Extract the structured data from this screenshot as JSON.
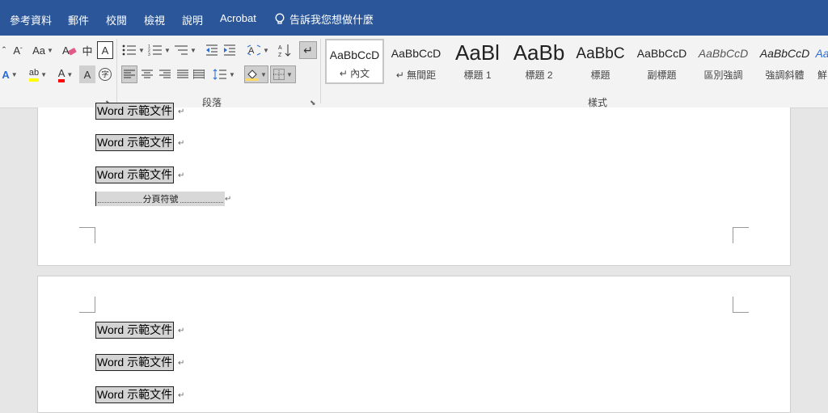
{
  "menu": {
    "tabs": [
      "參考資料",
      "郵件",
      "校閱",
      "檢視",
      "說明",
      "Acrobat"
    ],
    "tell_me": "告訴我您想做什麼"
  },
  "ribbon": {
    "font_group": {
      "case_button": "Aa",
      "phonetic_button": "中",
      "char_border_button": "A",
      "text_effect_button": "A",
      "highlight_button": "ab",
      "font_color_button": "A",
      "char_shade_button": "A",
      "enclose_button": "字"
    },
    "paragraph_group": {
      "label": "段落"
    },
    "styles_group": {
      "label": "樣式",
      "items": [
        {
          "sample": "AaBbCcD",
          "name": "↵ 內文"
        },
        {
          "sample": "AaBbCcD",
          "name": "↵ 無間距"
        },
        {
          "sample": "AaBl",
          "name": "標題 1"
        },
        {
          "sample": "AaBb",
          "name": "標題 2"
        },
        {
          "sample": "AaBbC",
          "name": "標題"
        },
        {
          "sample": "AaBbCcD",
          "name": "副標題"
        },
        {
          "sample": "AaBbCcD",
          "name": "區別強調"
        },
        {
          "sample": "AaBbCcD",
          "name": "強調斜體"
        },
        {
          "sample": "Aa",
          "name": "鮮"
        }
      ]
    }
  },
  "document": {
    "page1_lines": [
      "Word 示範文件",
      "Word 示範文件",
      "Word 示範文件"
    ],
    "page_break_label": "分頁符號",
    "page2_lines": [
      "Word 示範文件",
      "Word 示範文件",
      "Word 示範文件"
    ],
    "paragraph_mark": "↵"
  },
  "colors": {
    "title_bar": "#2b579a",
    "highlight_yellow": "#ffff00",
    "font_color_red": "#ff0000"
  }
}
